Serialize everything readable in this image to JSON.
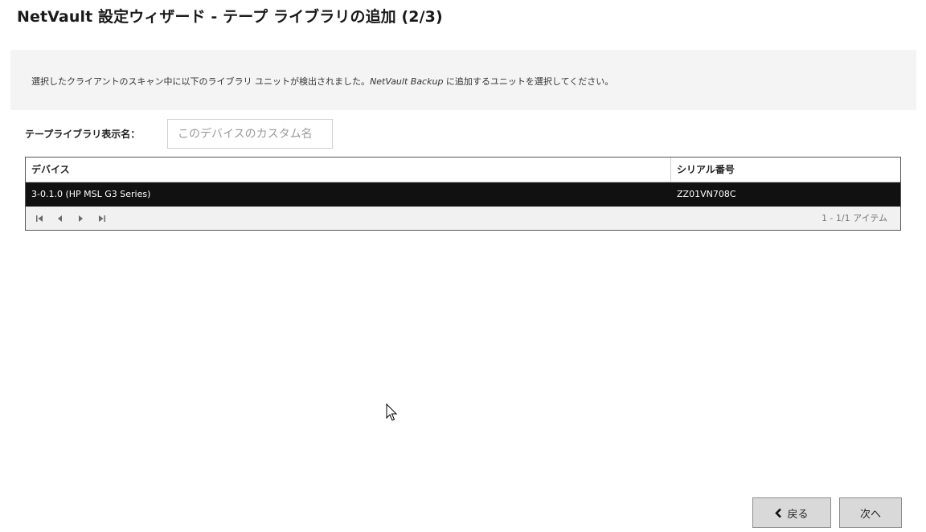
{
  "window": {
    "title": "NetVault 設定ウィザード - テープ ライブラリの追加 (2/3)"
  },
  "info": {
    "text_before": "選択したクライアントのスキャン中に以下のライブラリ ユニットが検出されました。",
    "product_name": "NetVault Backup",
    "text_after": " に追加するユニットを選択してください。"
  },
  "form": {
    "library_name_label": "テープライブラリ表示名：",
    "library_name_placeholder": "このデバイスのカスタム名",
    "library_name_value": ""
  },
  "table": {
    "columns": [
      "デバイス",
      "シリアル番号"
    ],
    "rows": [
      {
        "device": "3-0.1.0 (HP MSL G3 Series)",
        "serial": "ZZ01VN708C",
        "selected": true
      }
    ],
    "pager": {
      "summary": "1 - 1/1 アイテム",
      "icons": [
        "first-page-icon",
        "prev-page-icon",
        "next-page-icon",
        "last-page-icon"
      ]
    }
  },
  "footer": {
    "back_label": "戻る",
    "next_label": "次へ"
  },
  "colors": {
    "selected_row_bg": "#111111",
    "panel_bg": "#f4f4f4",
    "button_bg": "#d9d9d9"
  }
}
